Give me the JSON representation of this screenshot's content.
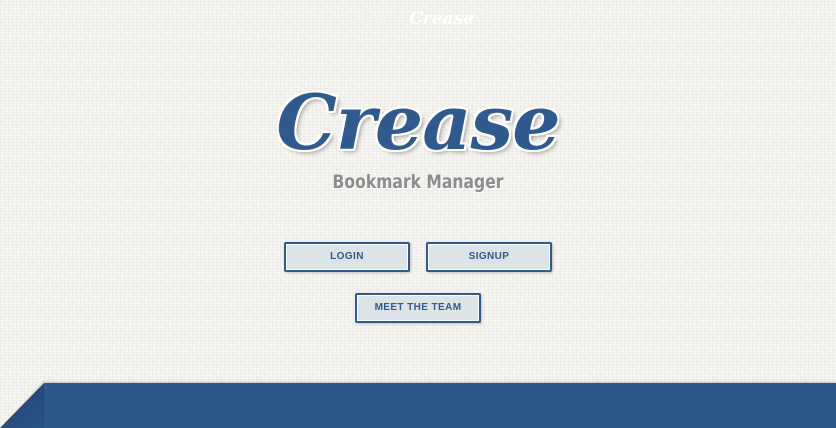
{
  "brand": {
    "logo": "Crease",
    "subtitle": "Bookmark Manager"
  },
  "buttons": {
    "login": "LOGIN",
    "signup": "SIGNUP",
    "team": "MEET THE TEAM"
  },
  "footer": {
    "prefix": "What is",
    "brand": "Crease",
    "suffix": "?"
  },
  "colors": {
    "accent": "#2f5a8f",
    "background": "#f6f5f1",
    "subtitle": "#8d8d8d",
    "button_fill": "#dde4e7"
  }
}
